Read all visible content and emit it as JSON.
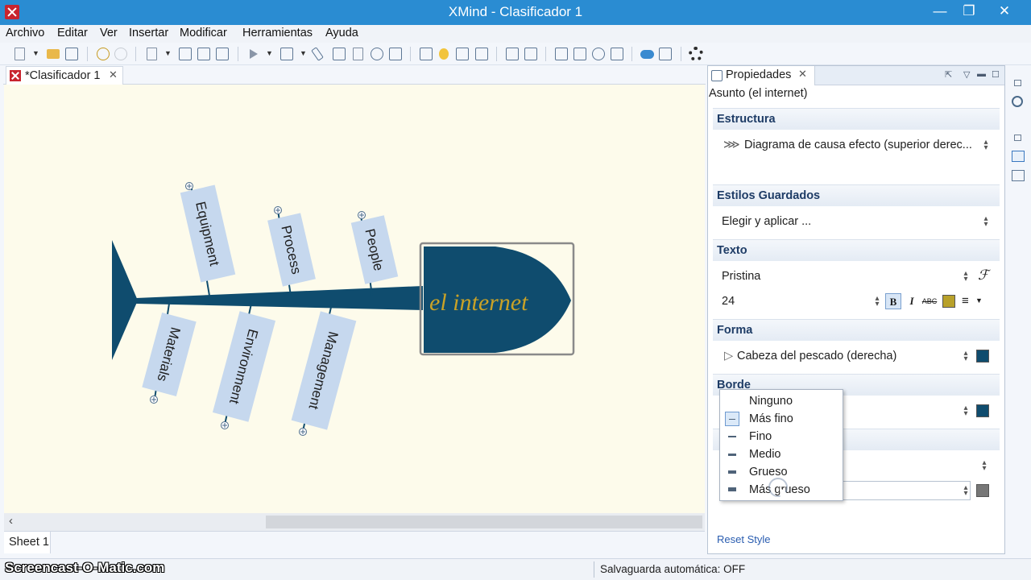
{
  "window": {
    "title": "XMind - Clasificador 1",
    "minimize": "—",
    "maximize": "❐",
    "close": "✕"
  },
  "menu": [
    "Archivo",
    "Editar",
    "Ver",
    "Insertar",
    "Modificar",
    "Herramientas",
    "Ayuda"
  ],
  "editor": {
    "tab_label": "*Clasificador 1",
    "tab_close": "✕",
    "sheet_tab": "Sheet 1"
  },
  "fishbone": {
    "head_label": "el internet",
    "head_fill": "#0f4c6e",
    "head_label_color": "#c9a227",
    "branch_fill": "#c6d8ee",
    "bones_top": [
      "Equipment",
      "Process",
      "People"
    ],
    "bones_bottom": [
      "Materials",
      "Environment",
      "Management"
    ]
  },
  "properties": {
    "tab_label": "Propiedades",
    "tab_close": "✕",
    "subject": "Asunto (el internet)",
    "sections": {
      "estructura": {
        "title": "Estructura",
        "value": "Diagrama de causa efecto (superior derec..."
      },
      "estilos": {
        "title": "Estilos Guardados",
        "value": "Elegir y aplicar ..."
      },
      "texto": {
        "title": "Texto",
        "font": "Pristina",
        "size": "24",
        "bold": "B",
        "italic": "I",
        "strike": "ABC",
        "font_icon": "ℱ",
        "color": "#b8a12a"
      },
      "forma": {
        "title": "Forma",
        "value": "Cabeza del pescado (derecha)",
        "color": "#0f4c6e"
      },
      "borde": {
        "title": "Borde",
        "color": "#0f4c6e"
      },
      "linea": {
        "color": "#777777"
      }
    },
    "reset_style": "Reset Style"
  },
  "border_width_dropdown": {
    "options": [
      "Ninguno",
      "Más fino",
      "Fino",
      "Medio",
      "Grueso",
      "Más grueso"
    ],
    "selected": "Más fino"
  },
  "status": {
    "autosave": "Salvaguarda automática: OFF",
    "watermark": "Screencast-O-Matic.com"
  }
}
